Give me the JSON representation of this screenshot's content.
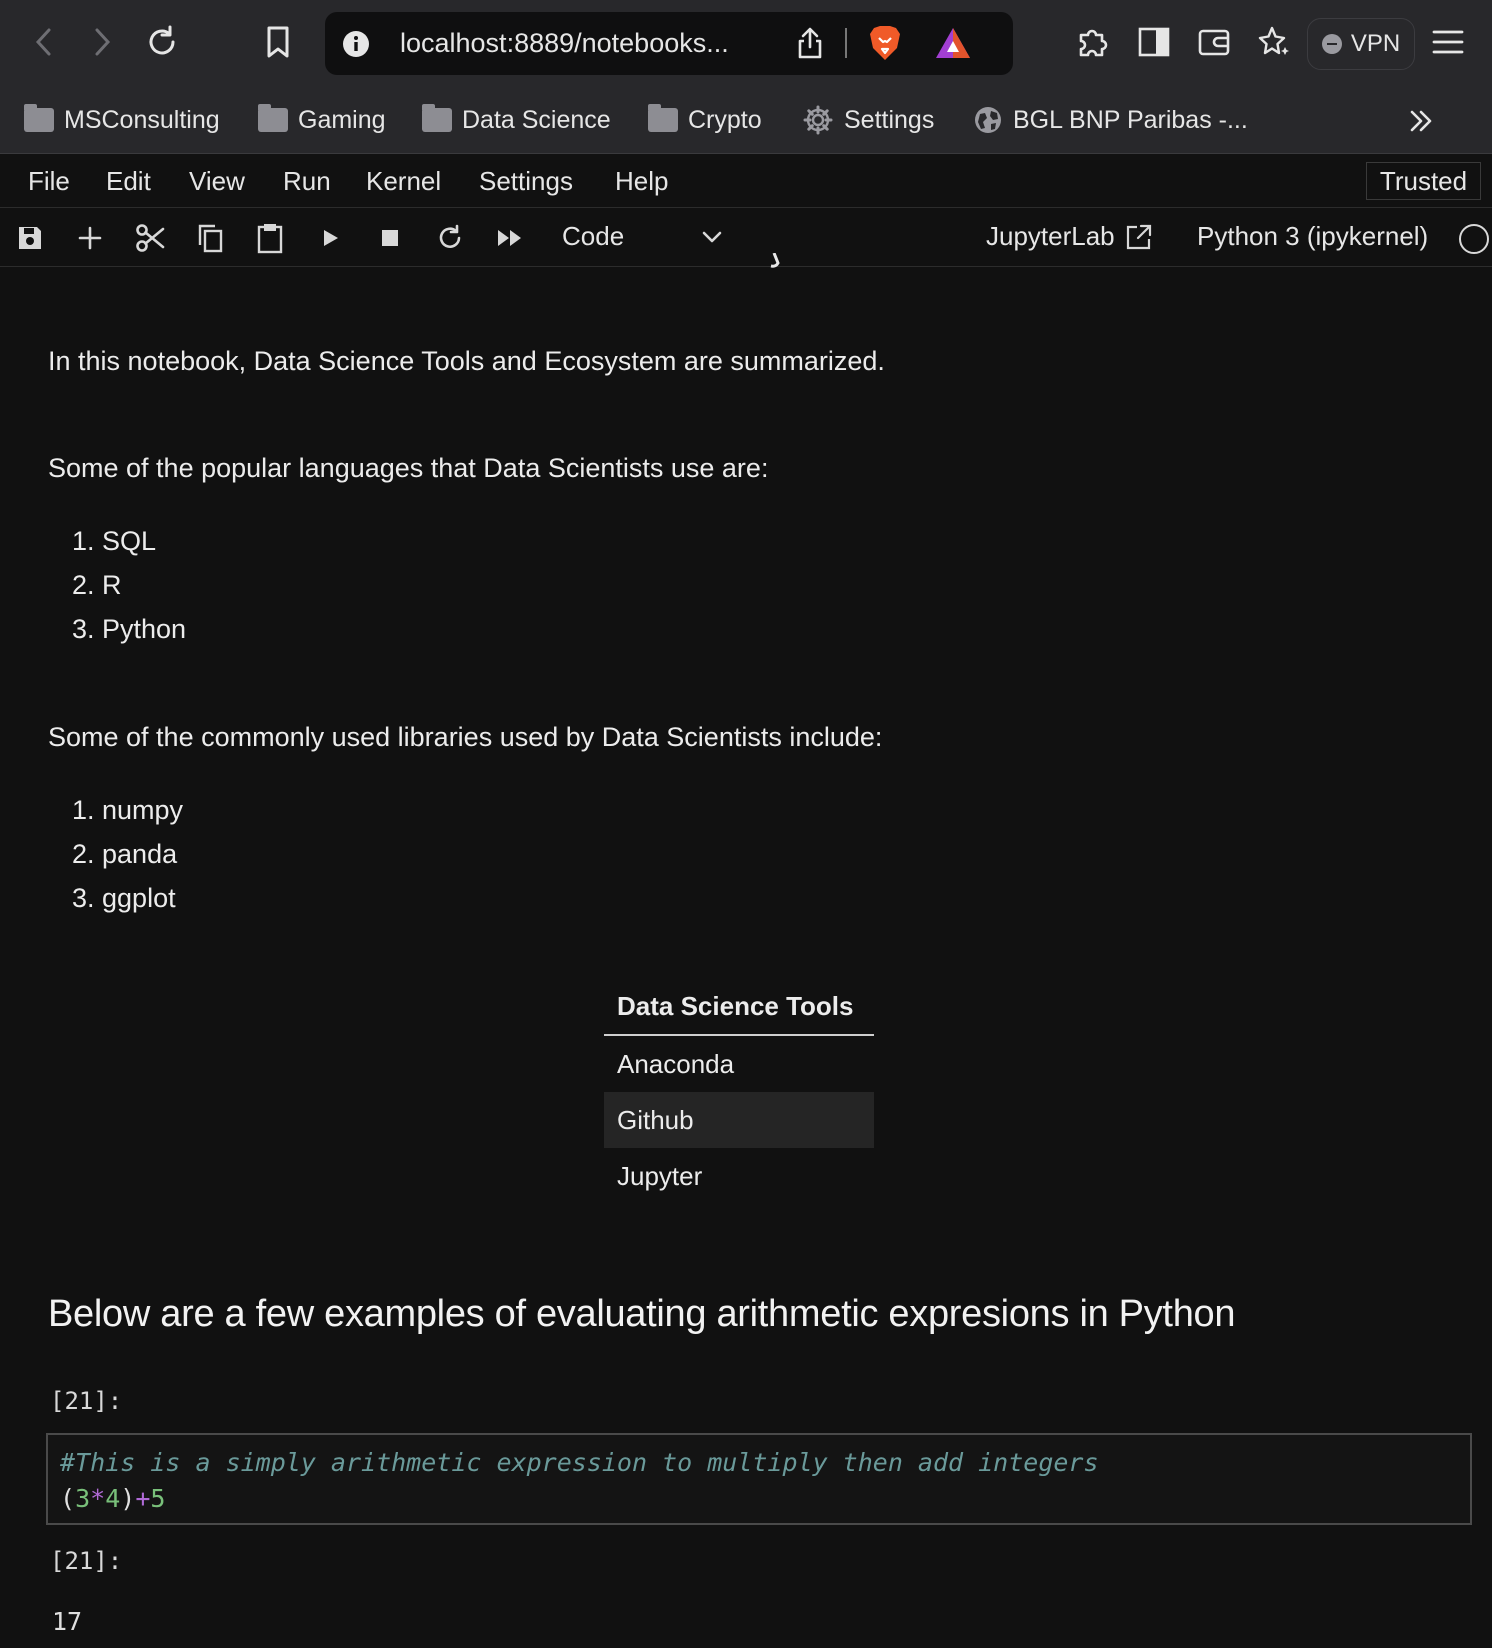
{
  "browser": {
    "url": "localhost:8889/notebooks...",
    "vpn_label": "VPN"
  },
  "bookmarks": {
    "items": [
      {
        "label": "MSConsulting",
        "icon": "folder-icon"
      },
      {
        "label": "Gaming",
        "icon": "folder-icon"
      },
      {
        "label": "Data Science",
        "icon": "folder-icon"
      },
      {
        "label": "Crypto",
        "icon": "folder-icon"
      },
      {
        "label": "Settings",
        "icon": "gear-icon"
      },
      {
        "label": "BGL BNP Paribas -...",
        "icon": "globe-icon"
      }
    ],
    "overflow_icon": "double-chevron-right-icon"
  },
  "menu": {
    "items": [
      "File",
      "Edit",
      "View",
      "Run",
      "Kernel",
      "Settings",
      "Help"
    ],
    "trusted_label": "Trusted"
  },
  "toolbar": {
    "cell_type": "Code",
    "jupyterlab_label": "JupyterLab",
    "kernel_label": "Python 3 (ipykernel)"
  },
  "notebook": {
    "intro": "In this notebook, Data Science Tools and Ecosystem are summarized.",
    "languages_intro": "Some of the popular languages that Data Scientists use are:",
    "languages": [
      "1. SQL",
      "2. R",
      "3. Python"
    ],
    "libraries_intro": "Some of the commonly used libraries used by Data Scientists include:",
    "libraries": [
      "1. numpy",
      "2. panda",
      "3. ggplot"
    ],
    "tools_table": {
      "header": "Data Science Tools",
      "rows": [
        "Anaconda",
        "Github",
        "Jupyter"
      ]
    },
    "section_heading": "Below are a few examples of evaluating arithmetic expresions in Python",
    "code_cell": {
      "input_prompt": "[21]:",
      "comment": "#This is a simply arithmetic expression to multiply then add integers",
      "tokens": {
        "open": "(",
        "a": "3",
        "op1": "*",
        "b": "4",
        "close": ")",
        "op2": "+",
        "c": "5"
      },
      "output_prompt": "[21]:",
      "output": "17"
    }
  },
  "colors": {
    "background": "#111111",
    "browser_chrome": "#28282b",
    "code_comment": "#6a9a9a",
    "code_number": "#79c07a",
    "code_operator": "#b06ad6"
  }
}
